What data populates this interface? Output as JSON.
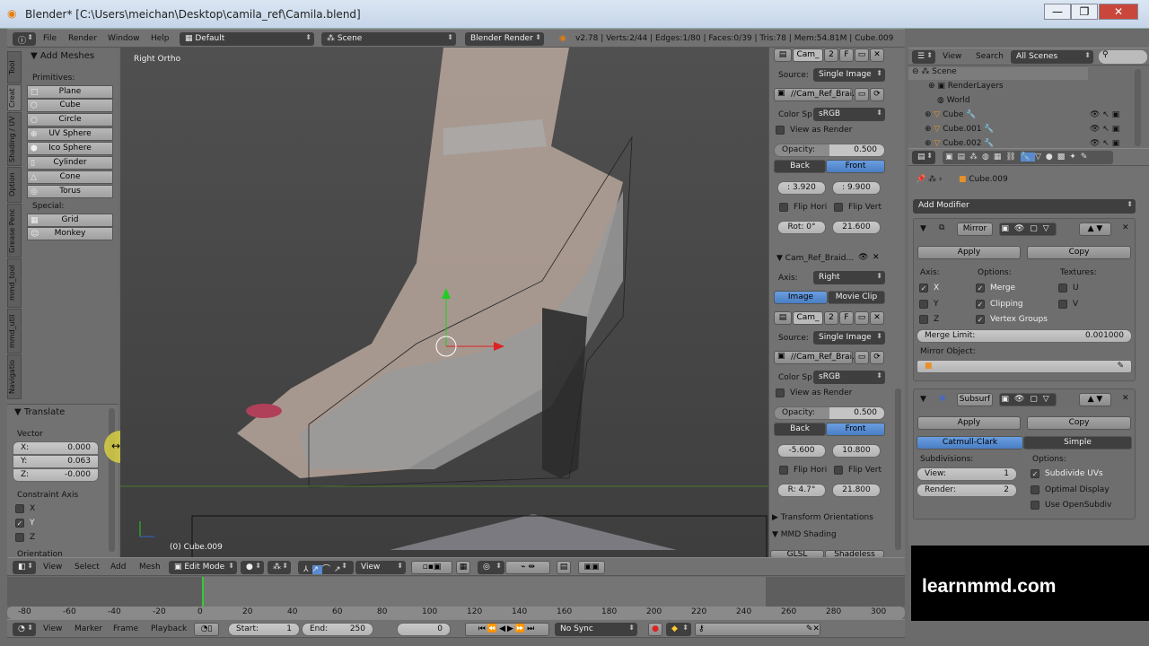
{
  "window": {
    "title": "Blender* [C:\\Users\\meichan\\Desktop\\camila_ref\\Camila.blend]",
    "min": "—",
    "max": "❐",
    "close": "✕"
  },
  "menubar": {
    "items": [
      "File",
      "Render",
      "Window",
      "Help"
    ],
    "layout": "Default",
    "scene": "Scene",
    "engine": "Blender Render",
    "stats": "v2.78 | Verts:2/44 | Edges:1/80 | Faces:0/39 | Tris:78 | Mem:54.81M | Cube.009"
  },
  "toolshelf": {
    "tabs": [
      "Tool",
      "Creat",
      "Shading / UV",
      "Option",
      "Grease Penc",
      "mmd_tool",
      "mmd_util",
      "Navigatio"
    ],
    "panel_title": "Add Meshes",
    "primitives_label": "Primitives:",
    "primitives": [
      "Plane",
      "Cube",
      "Circle",
      "UV Sphere",
      "Ico Sphere",
      "Cylinder",
      "Cone",
      "Torus"
    ],
    "special_label": "Special:",
    "special": [
      "Grid",
      "Monkey"
    ]
  },
  "operator": {
    "title": "Translate",
    "vector_label": "Vector",
    "x_label": "X:",
    "x": "0.000",
    "y_label": "Y:",
    "y": "0.063",
    "z_label": "Z:",
    "z": "-0.000",
    "constraint_label": "Constraint Axis",
    "axes": [
      {
        "label": "X",
        "checked": false
      },
      {
        "label": "Y",
        "checked": true
      },
      {
        "label": "Z",
        "checked": false
      }
    ],
    "orientation_label": "Orientation"
  },
  "viewport": {
    "view_label": "Right Ortho",
    "object_label": "(0) Cube.009"
  },
  "npanel": {
    "bg1": {
      "img_name": "Cam_",
      "users": "2",
      "fake": "F",
      "source_label": "Source:",
      "source": "Single Image",
      "path": "//Cam_Ref_Brai...",
      "colorspace_label": "Color Sp",
      "colorspace": "sRGB",
      "view_as_render": "View as Render",
      "opacity_label": "Opacity:",
      "opacity": "0.500",
      "back": "Back",
      "front": "Front",
      "x": ": 3.920",
      "y": ": 9.900",
      "flip_h": "Flip Hori",
      "flip_v": "Flip Vert",
      "rot": "Rot: 0°",
      "size": "21.600"
    },
    "bg2": {
      "title": "Cam_Ref_Braid...",
      "axis_label": "Axis:",
      "axis": "Right",
      "image": "Image",
      "movie_clip": "Movie Clip",
      "img_name": "Cam_",
      "users": "2",
      "fake": "F",
      "source_label": "Source:",
      "source": "Single Image",
      "path": "//Cam_Ref_Brai...",
      "colorspace_label": "Color Sp",
      "colorspace": "sRGB",
      "view_as_render": "View as Render",
      "opacity_label": "Opacity:",
      "opacity": "0.500",
      "back": "Back",
      "front": "Front",
      "x": "-5.600",
      "y": "10.800",
      "flip_h": "Flip Hori",
      "flip_v": "Flip Vert",
      "rot": "R: 4.7°",
      "size": "21.800"
    },
    "transform_orientations": "Transform Orientations",
    "mmd_shading": "MMD Shading",
    "glsl": "GLSL",
    "shadeless": "Shadeless"
  },
  "outliner": {
    "view": "View",
    "search": "Search",
    "filter": "All Scenes",
    "items": [
      "Scene",
      "RenderLayers",
      "World",
      "Cube",
      "Cube.001",
      "Cube.002"
    ]
  },
  "properties": {
    "object": "Cube.009",
    "add_modifier": "Add Modifier",
    "mirror": {
      "name": "Mirror",
      "apply": "Apply",
      "copy": "Copy",
      "axis_label": "Axis:",
      "options_label": "Options:",
      "textures_label": "Textures:",
      "x": "X",
      "y": "Y",
      "z": "Z",
      "merge": "Merge",
      "clipping": "Clipping",
      "vgroups": "Vertex Groups",
      "u": "U",
      "v": "V",
      "merge_limit_label": "Merge Limit:",
      "merge_limit": "0.001000",
      "mirror_object_label": "Mirror Object:"
    },
    "subsurf": {
      "name": "Subsurf",
      "apply": "Apply",
      "copy": "Copy",
      "catmull": "Catmull-Clark",
      "simple": "Simple",
      "subdiv_label": "Subdivisions:",
      "options_label": "Options:",
      "view_label": "View:",
      "view": "1",
      "render_label": "Render:",
      "render": "2",
      "subdiv_uvs": "Subdivide UVs",
      "optimal": "Optimal Display",
      "opensubdiv": "Use OpenSubdiv"
    }
  },
  "view3d_header": {
    "items": [
      "View",
      "Select",
      "Add",
      "Mesh"
    ],
    "mode": "Edit Mode",
    "orientation": "View"
  },
  "timeline": {
    "ticks": [
      "-80",
      "-60",
      "-40",
      "-20",
      "0",
      "20",
      "40",
      "60",
      "80",
      "100",
      "120",
      "140",
      "160",
      "180",
      "200",
      "220",
      "240",
      "260",
      "280",
      "300"
    ],
    "current_frame_value": 0,
    "menu": [
      "View",
      "Marker",
      "Frame",
      "Playback"
    ],
    "start_label": "Start:",
    "start": "1",
    "end_label": "End:",
    "end": "250",
    "frame": "0",
    "sync": "No Sync"
  },
  "watermark": "learnmmd.com"
}
